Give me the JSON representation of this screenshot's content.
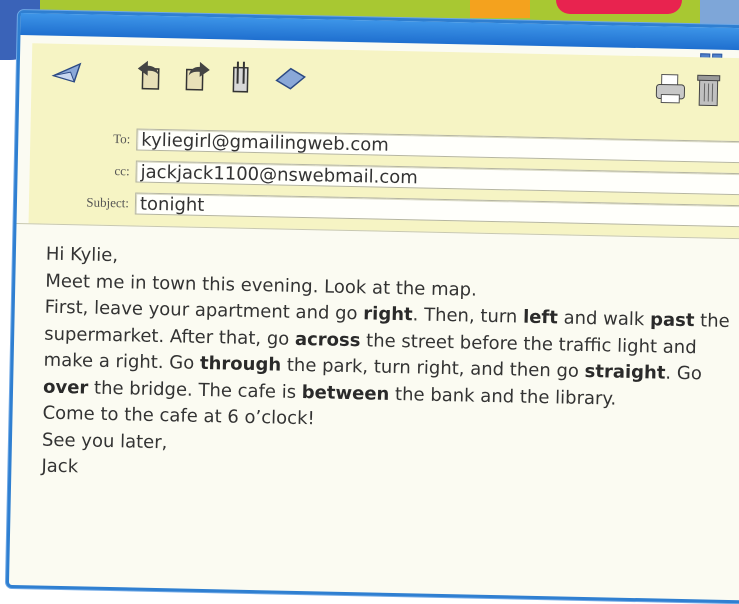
{
  "toolbar": {
    "icons": [
      "send-icon",
      "reply-icon",
      "forward-icon",
      "attach-icon",
      "address-book-icon",
      "print-icon",
      "trash-icon"
    ]
  },
  "fields": {
    "to_label": "To:",
    "to_value": "kyliegirl@gmailingweb.com",
    "cc_label": "cc:",
    "cc_value": "jackjack1100@nswebmail.com",
    "subject_label": "Subject:",
    "subject_value": "tonight"
  },
  "message": {
    "greeting": "Hi Kylie,",
    "line1": "Meet me in town this evening. Look at the map.",
    "directions": [
      {
        "text": "First, leave your apartment and go "
      },
      {
        "text": "right",
        "bold": true
      },
      {
        "text": ". Then, turn "
      },
      {
        "text": "left",
        "bold": true
      },
      {
        "text": " and walk "
      },
      {
        "text": "past",
        "bold": true
      },
      {
        "text": " the supermarket. After that, go "
      },
      {
        "text": "across",
        "bold": true
      },
      {
        "text": " the street before the traffic light and make a right. Go "
      },
      {
        "text": "through",
        "bold": true
      },
      {
        "text": " the park, turn right, and then go "
      },
      {
        "text": "straight",
        "bold": true
      },
      {
        "text": ". Go "
      },
      {
        "text": "over",
        "bold": true
      },
      {
        "text": " the bridge. The cafe is "
      },
      {
        "text": "between",
        "bold": true
      },
      {
        "text": " the bank and the library."
      }
    ],
    "line3": "Come to the cafe at 6 o’clock!",
    "closing": "See you later,",
    "signature": "Jack"
  },
  "colors": {
    "window_border": "#2f7fd1",
    "header_bg": "#f6f4c4",
    "body_bg": "#fbfbf2"
  }
}
